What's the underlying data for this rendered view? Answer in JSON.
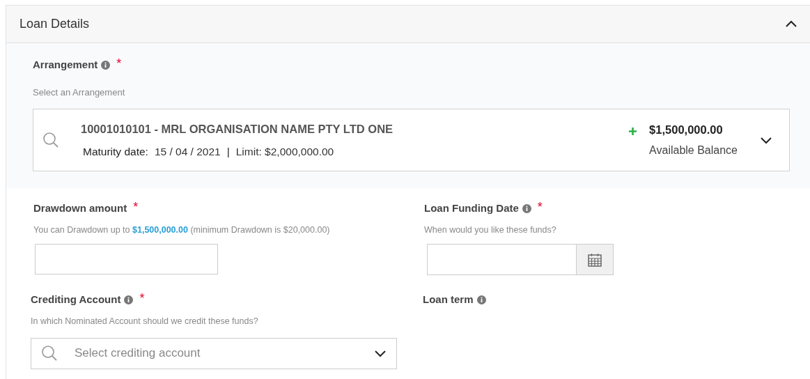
{
  "panel": {
    "title": "Loan Details",
    "expanded": true
  },
  "arrangement": {
    "label": "Arrangement",
    "info": true,
    "required_mark": "*",
    "hint": "Select an Arrangement",
    "selected": {
      "account": "10001010101 - MRL ORGANISATION NAME PTY LTD ONE",
      "maturity_label": "Maturity date:",
      "maturity_date": "15 / 04 / 2021",
      "separator": "|",
      "limit": "Limit: $2,000,000.00",
      "balance": "$1,500,000.00",
      "balance_label": "Available Balance"
    }
  },
  "fields": [
    {
      "kind": "amount",
      "label": "Drawdown amount",
      "info": false,
      "required_mark": "*",
      "hint": "You can Drawdown up to **$1,500,000.00** (minimum Drawdown is $20,000.00)"
    },
    {
      "kind": "date",
      "label": "Loan Funding Date",
      "info": true,
      "required_mark": "*",
      "hint": "When would you like these funds?"
    },
    {
      "kind": "select",
      "label": "Crediting Account",
      "info": true,
      "required_mark": "*",
      "hint": "In which Nominated Account should we credit these funds?",
      "placeholder": "Select crediting account"
    },
    {
      "kind": "text",
      "label": "Loan term",
      "info": true
    }
  ]
}
